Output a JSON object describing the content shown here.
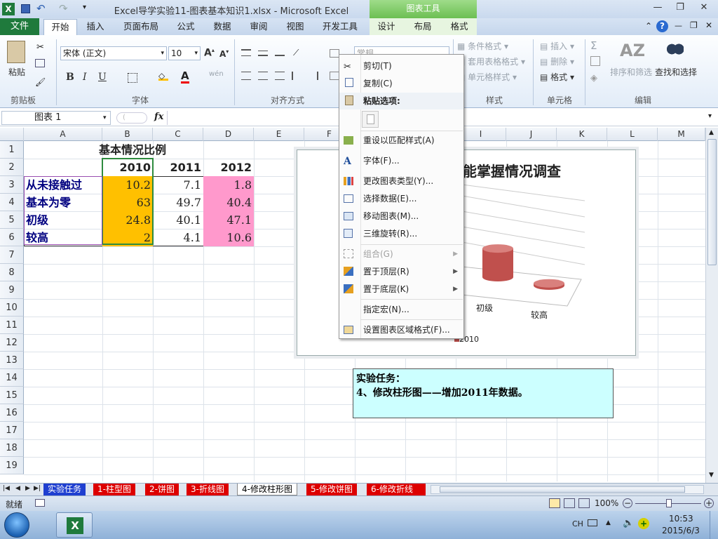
{
  "window": {
    "title": "Excel导学实验11-图表基本知识1.xlsx - Microsoft Excel",
    "context_group": "图表工具"
  },
  "tabs": {
    "file": "文件",
    "items": [
      "开始",
      "插入",
      "页面布局",
      "公式",
      "数据",
      "审阅",
      "视图",
      "开发工具"
    ],
    "context": [
      "设计",
      "布局",
      "格式"
    ]
  },
  "ribbon": {
    "clipboard": {
      "paste": "粘贴",
      "label": "剪贴板"
    },
    "font": {
      "name": "宋体 (正文)",
      "size": "10",
      "label": "字体",
      "bold": "B",
      "italic": "I",
      "underline": "U",
      "wen": "wén"
    },
    "align": {
      "label": "对齐方式"
    },
    "number": {
      "format": "常规"
    },
    "styles": {
      "conditional": "条件格式",
      "table": "套用表格格式",
      "cell": "单元格样式",
      "label": "样式"
    },
    "cells": {
      "insert": "插入",
      "delete": "删除",
      "format": "格式",
      "label": "单元格"
    },
    "editing": {
      "sort": "排序和筛选",
      "find": "查找和选择",
      "label": "编辑",
      "sigma": "Σ"
    }
  },
  "formula_bar": {
    "name_box": "图表 1",
    "fx": "fx",
    "value": ""
  },
  "columns": [
    "A",
    "B",
    "C",
    "D",
    "E",
    "F",
    "G",
    "H",
    "I",
    "J",
    "K",
    "L",
    "M"
  ],
  "rows": [
    "1",
    "2",
    "3",
    "4",
    "5",
    "6",
    "7",
    "8",
    "9",
    "10",
    "11",
    "12",
    "13",
    "14",
    "15",
    "16",
    "17",
    "18",
    "19"
  ],
  "sheet": {
    "title": "基本情况比例",
    "headers": [
      "2010",
      "2011",
      "2012"
    ],
    "data": [
      {
        "label": "从未接触过",
        "v2010": "10.2",
        "v2011": "7.1",
        "v2012": "1.8"
      },
      {
        "label": "基本为零",
        "v2010": "63",
        "v2011": "49.7",
        "v2012": "40.4"
      },
      {
        "label": "初级",
        "v2010": "24.8",
        "v2011": "40.1",
        "v2012": "47.1"
      },
      {
        "label": "较高",
        "v2010": "2",
        "v2011": "4.1",
        "v2012": "10.6"
      }
    ]
  },
  "chart": {
    "title_visible": "能掌握情况调查",
    "cat_labels": [
      "初级",
      "较高"
    ],
    "legend": "2010",
    "color": "#c0504d"
  },
  "chart_data": {
    "type": "bar",
    "title": "能掌握情况调查",
    "categories": [
      "初级",
      "较高"
    ],
    "series": [
      {
        "name": "2010",
        "values": [
          24.8,
          2
        ]
      }
    ]
  },
  "task": {
    "line1": "实验任务：",
    "line2": "4、修改柱形图——增加2011年数据。"
  },
  "context_menu": {
    "items": [
      {
        "label": "剪切(T)",
        "icon": "cut-icon",
        "enabled": true
      },
      {
        "label": "复制(C)",
        "icon": "copy-icon",
        "enabled": true
      },
      {
        "label": "粘贴选项:",
        "icon": "paste-icon",
        "enabled": true,
        "bold": true
      },
      {
        "label": "重设以匹配样式(A)",
        "icon": "reset-style-icon",
        "enabled": true
      },
      {
        "label": "字体(F)...",
        "icon": "font-icon",
        "enabled": true
      },
      {
        "label": "更改图表类型(Y)...",
        "icon": "chart-type-icon",
        "enabled": true
      },
      {
        "label": "选择数据(E)...",
        "icon": "select-data-icon",
        "enabled": true
      },
      {
        "label": "移动图表(M)...",
        "icon": "move-chart-icon",
        "enabled": true
      },
      {
        "label": "三维旋转(R)...",
        "icon": "rotate-3d-icon",
        "enabled": true
      },
      {
        "label": "组合(G)",
        "icon": "group-icon",
        "enabled": false
      },
      {
        "label": "置于顶层(R)",
        "icon": "bring-front-icon",
        "enabled": true
      },
      {
        "label": "置于底层(K)",
        "icon": "send-back-icon",
        "enabled": true
      },
      {
        "label": "指定宏(N)...",
        "icon": "",
        "enabled": true
      },
      {
        "label": "设置图表区域格式(F)...",
        "icon": "format-chart-icon",
        "enabled": true
      }
    ]
  },
  "sheet_tabs": [
    "实验任务",
    "1-柱型图",
    "2-饼图",
    "3-折线图",
    "4-修改柱形图",
    "5-修改饼图",
    "6-修改折线"
  ],
  "active_sheet_tab": "4-修改柱形图",
  "status": {
    "ready": "就绪",
    "zoom": "100%"
  },
  "taskbar": {
    "time": "10:53",
    "date": "2015/6/3",
    "lang": "CH"
  }
}
